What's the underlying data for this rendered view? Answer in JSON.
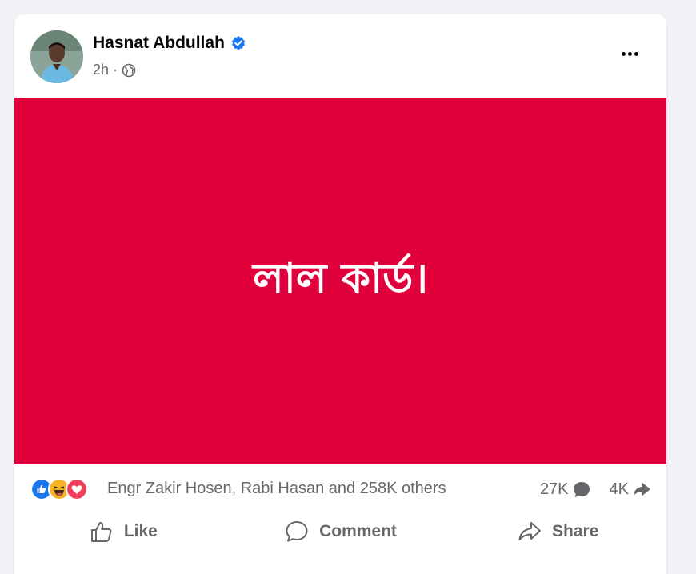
{
  "post": {
    "author": "Hasnat Abdullah",
    "verified": true,
    "time": "2h",
    "separator": "·",
    "privacy_icon": "globe-icon",
    "image_text": "লাল কার্ড।",
    "image_background": "#e0003c"
  },
  "stats": {
    "reaction_icons": [
      "like-icon",
      "haha-icon",
      "love-icon"
    ],
    "reaction_summary": "Engr Zakir Hosen, Rabi Hasan and 258K others",
    "comments": "27K",
    "shares": "4K"
  },
  "actions": {
    "like": "Like",
    "comment": "Comment",
    "share": "Share"
  },
  "colors": {
    "accent": "#1877f2",
    "text_secondary": "#65676b",
    "love": "#f33e58",
    "haha": "#f7b125"
  }
}
